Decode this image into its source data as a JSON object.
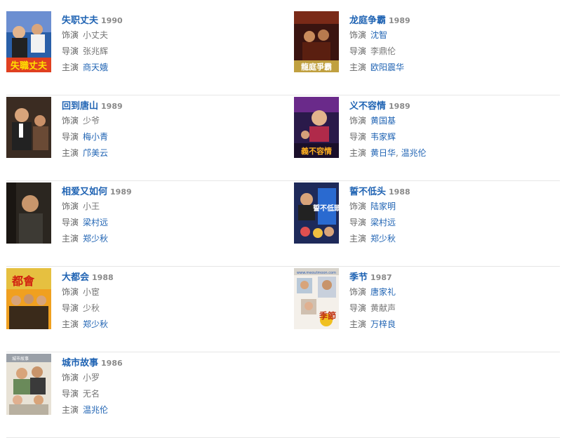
{
  "labels": {
    "role": "饰演",
    "director": "导演",
    "star": "主演"
  },
  "colors": {
    "link": "#1f63b3",
    "year": "#8a8a8a",
    "label": "#666666",
    "divider": "#e6e6e6"
  },
  "items": [
    {
      "title": "失职丈夫",
      "year": "1990",
      "role": {
        "text": "小丈夫",
        "link": false
      },
      "director": {
        "text": "张兆辉",
        "link": false
      },
      "stars": [
        {
          "text": "商天娥",
          "link": true
        }
      ]
    },
    {
      "title": "龙庭争霸",
      "year": "1989",
      "role": {
        "text": "沈智",
        "link": true
      },
      "director": {
        "text": "李鼎伦",
        "link": false
      },
      "stars": [
        {
          "text": "欧阳震华",
          "link": true
        }
      ]
    },
    {
      "title": "回到唐山",
      "year": "1989",
      "role": {
        "text": "少爷",
        "link": false
      },
      "director": {
        "text": "梅小青",
        "link": true
      },
      "stars": [
        {
          "text": "邝美云",
          "link": true
        }
      ]
    },
    {
      "title": "义不容情",
      "year": "1989",
      "role": {
        "text": "黄国基",
        "link": true
      },
      "director": {
        "text": "韦家辉",
        "link": true
      },
      "stars": [
        {
          "text": "黄日华",
          "link": true
        },
        {
          "text": "温兆伦",
          "link": true
        }
      ]
    },
    {
      "title": "相爱又如何",
      "year": "1989",
      "role": {
        "text": "小王",
        "link": false
      },
      "director": {
        "text": "梁村远",
        "link": true
      },
      "stars": [
        {
          "text": "郑少秋",
          "link": true
        }
      ]
    },
    {
      "title": "誓不低头",
      "year": "1988",
      "role": {
        "text": "陆家明",
        "link": true
      },
      "director": {
        "text": "梁村远",
        "link": true
      },
      "stars": [
        {
          "text": "郑少秋",
          "link": true
        }
      ]
    },
    {
      "title": "大都会",
      "year": "1988",
      "role": {
        "text": "小宦",
        "link": false
      },
      "director": {
        "text": "少秋",
        "link": false
      },
      "stars": [
        {
          "text": "郑少秋",
          "link": true
        }
      ]
    },
    {
      "title": "季节",
      "year": "1987",
      "role": {
        "text": "唐家礼",
        "link": true
      },
      "director": {
        "text": "黄献声",
        "link": false
      },
      "stars": [
        {
          "text": "万梓良",
          "link": true
        }
      ]
    },
    {
      "title": "城市故事",
      "year": "1986",
      "role": {
        "text": "小罗",
        "link": false
      },
      "director": {
        "text": "无名",
        "link": false
      },
      "stars": [
        {
          "text": "温兆伦",
          "link": true
        }
      ]
    }
  ],
  "poster_art": {
    "p1_text": "失職丈夫",
    "p2_text": "龍庭爭霸",
    "p4_text": "義不容情",
    "p6_text": "誓不低頭",
    "p7_text": "都會",
    "p8_url": "www.meoutmoon.com",
    "p8_text": "季節",
    "p9_text": "城市故事"
  }
}
